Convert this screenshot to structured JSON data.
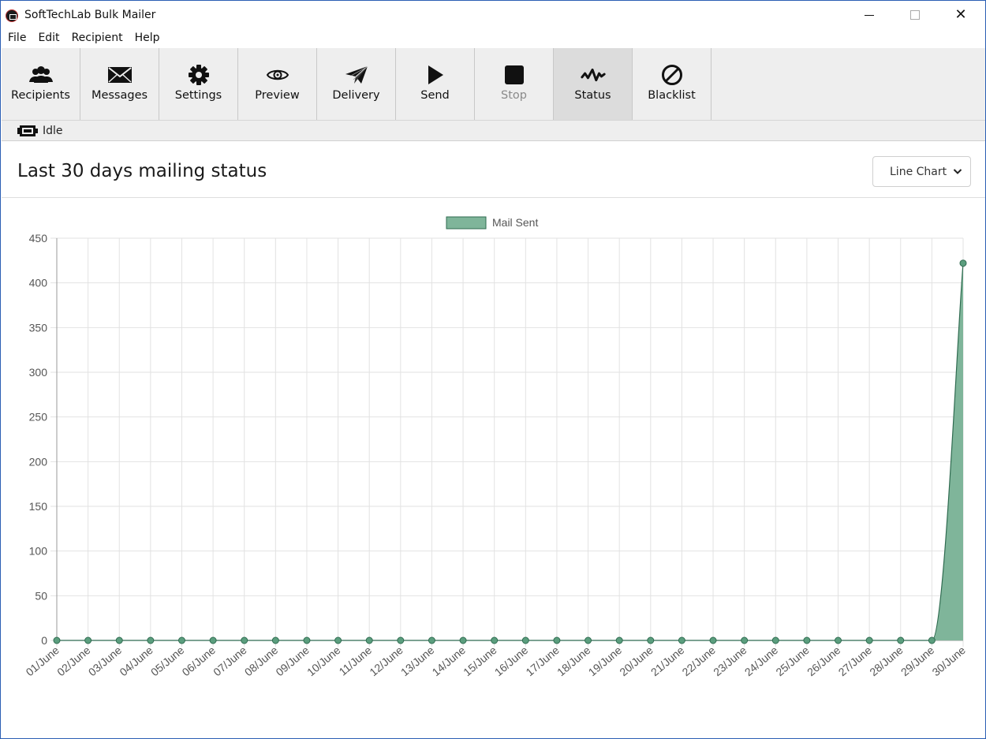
{
  "window": {
    "title": "SoftTechLab Bulk Mailer",
    "controls": {
      "minimize": "—",
      "maximize": "□",
      "close": "✕"
    }
  },
  "menu": [
    "File",
    "Edit",
    "Recipient",
    "Help"
  ],
  "toolbar": [
    {
      "id": "recipients",
      "label": "Recipients",
      "icon": "users-icon",
      "state": "normal"
    },
    {
      "id": "messages",
      "label": "Messages",
      "icon": "envelope-icon",
      "state": "normal"
    },
    {
      "id": "settings",
      "label": "Settings",
      "icon": "gear-icon",
      "state": "normal"
    },
    {
      "id": "preview",
      "label": "Preview",
      "icon": "eye-icon",
      "state": "normal"
    },
    {
      "id": "delivery",
      "label": "Delivery",
      "icon": "paper-plane-icon",
      "state": "normal"
    },
    {
      "id": "send",
      "label": "Send",
      "icon": "play-icon",
      "state": "normal"
    },
    {
      "id": "stop",
      "label": "Stop",
      "icon": "stop-icon",
      "state": "disabled"
    },
    {
      "id": "status",
      "label": "Status",
      "icon": "pulse-icon",
      "state": "active"
    },
    {
      "id": "blacklist",
      "label": "Blacklist",
      "icon": "ban-icon",
      "state": "normal"
    }
  ],
  "status": {
    "icon": "plug-icon",
    "text": "Idle"
  },
  "page": {
    "title": "Last 30 days mailing status",
    "chart_type_select": {
      "selected": "Line Chart"
    }
  },
  "colors": {
    "series_fill": "#7fb59a",
    "series_line": "#2f6b50",
    "point_fill": "#5b9e7e",
    "grid": "#e2e2e2",
    "axis": "#9a9a9a",
    "tick_text": "#555555"
  },
  "chart_data": {
    "type": "area",
    "title": "",
    "xlabel": "",
    "ylabel": "",
    "legend": {
      "position": "top",
      "entries": [
        "Mail Sent"
      ]
    },
    "grid": true,
    "ylim": [
      0,
      450
    ],
    "yticks": [
      0,
      50,
      100,
      150,
      200,
      250,
      300,
      350,
      400,
      450
    ],
    "categories": [
      "01/June",
      "02/June",
      "03/June",
      "04/June",
      "05/June",
      "06/June",
      "07/June",
      "08/June",
      "09/June",
      "10/June",
      "11/June",
      "12/June",
      "13/June",
      "14/June",
      "15/June",
      "16/June",
      "17/June",
      "18/June",
      "19/June",
      "20/June",
      "21/June",
      "22/June",
      "23/June",
      "24/June",
      "25/June",
      "26/June",
      "27/June",
      "28/June",
      "29/June",
      "30/June"
    ],
    "series": [
      {
        "name": "Mail Sent",
        "values": [
          0,
          0,
          0,
          0,
          0,
          0,
          0,
          0,
          0,
          0,
          0,
          0,
          0,
          0,
          0,
          0,
          0,
          0,
          0,
          0,
          0,
          0,
          0,
          0,
          0,
          0,
          0,
          0,
          0,
          422
        ]
      }
    ]
  }
}
